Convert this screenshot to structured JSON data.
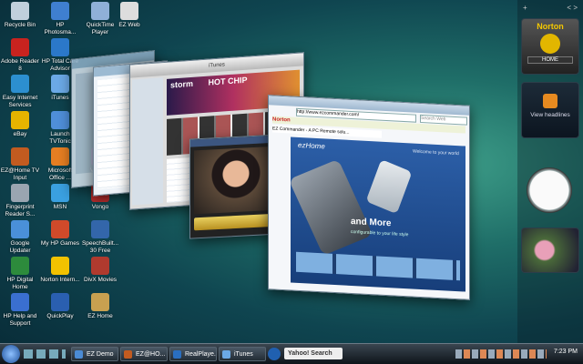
{
  "desktop": {
    "icons": [
      {
        "label": "Recycle Bin",
        "color": "#c0d0dc"
      },
      {
        "label": "HP Photosma...",
        "color": "#3f7fd0"
      },
      {
        "label": "QuickTime Player",
        "color": "#8fb0d8"
      },
      {
        "label": "EZ Web",
        "color": "#dddddd"
      },
      {
        "label": "Adobe Reader 8",
        "color": "#c8231f"
      },
      {
        "label": "HP Total Care Advisor",
        "color": "#2b78c9"
      },
      {
        "label": "Easy Internet Services",
        "color": "#2c8fd0"
      },
      {
        "label": "iTunes",
        "color": "#6ba9e6"
      },
      {
        "label": "eBay",
        "color": "#e5b400"
      },
      {
        "label": "Launch TVTonic",
        "color": "#4f8fd9"
      },
      {
        "label": "EZ@Home TV Input",
        "color": "#c25b20"
      },
      {
        "label": "Microsoft Office ...",
        "color": "#e67e22"
      },
      {
        "label": "Vonage",
        "color": "#7a2a8e"
      },
      {
        "label": "Fingerprint Reader S...",
        "color": "#9aa5b1"
      },
      {
        "label": "MSN",
        "color": "#3aa0e0"
      },
      {
        "label": "Vongo",
        "color": "#c03030"
      },
      {
        "label": "Google Updater",
        "color": "#4a90d9"
      },
      {
        "label": "My HP Games",
        "color": "#d04a2a"
      },
      {
        "label": "SpeechBuilt... 30 Free",
        "color": "#3366aa"
      },
      {
        "label": "HP Digital Home",
        "color": "#2d8b3c"
      },
      {
        "label": "Norton Intern...",
        "color": "#f2c200"
      },
      {
        "label": "DivX Movies",
        "color": "#b03a2e"
      },
      {
        "label": "HP Help and Support",
        "color": "#3a6fd0"
      },
      {
        "label": "QuickPlay",
        "color": "#2a5fb0"
      },
      {
        "label": "EZ Home",
        "color": "#c8a050"
      }
    ]
  },
  "windows": {
    "itunes_title": "iTunes",
    "ie_address": "http://www.ezcommander.com/",
    "ie_search": "Search Web",
    "ie_tab": "EZ Commander - A PC Remote solu...",
    "ie_brand": "ezHome",
    "ie_welcome": "Welcome to your world",
    "ie_headline1": "and More",
    "ie_headline2": "configurable to your life style",
    "storm_banner": "storm",
    "hot_chip": "HOT CHIP",
    "norton_toolbar": "Norton"
  },
  "sidebar": {
    "norton_title": "Norton",
    "norton_home": "HOME",
    "rss_label": "View headlines",
    "plus": "+",
    "nav": "< >"
  },
  "taskbar": {
    "buttons": [
      {
        "label": "EZ Demo",
        "color": "#4b8bd4"
      },
      {
        "label": "EZ@HO...",
        "color": "#c25b20"
      },
      {
        "label": "RealPlaye...",
        "color": "#2a6fc0"
      },
      {
        "label": "iTunes",
        "color": "#6ba9e6"
      }
    ],
    "search_placeholder": "Yahoo! Search",
    "clock": "7:23 PM"
  }
}
